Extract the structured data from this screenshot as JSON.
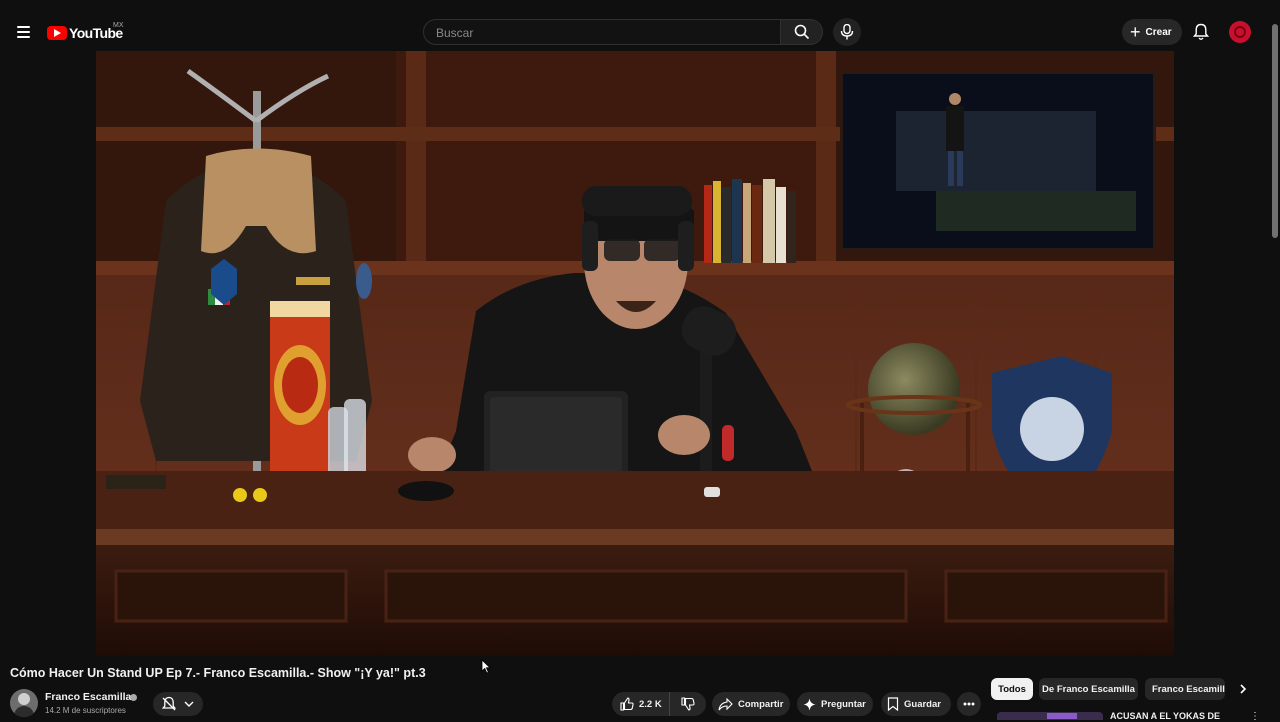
{
  "header": {
    "logo_text": "YouTube",
    "country_code": "MX",
    "search_placeholder": "Buscar",
    "create_label": "Crear"
  },
  "video": {
    "title": "Cómo Hacer Un Stand UP Ep 7.- Franco Escamilla.- Show \"¡Y ya!\" pt.3"
  },
  "channel": {
    "name": "Franco Escamilla",
    "subscribers": "14.2 M de suscriptores"
  },
  "actions": {
    "likes": "2.2 K",
    "share_label": "Compartir",
    "ask_label": "Preguntar",
    "save_label": "Guardar"
  },
  "chips": [
    "Todos",
    "De Franco Escamilla",
    "Franco Escamilla"
  ],
  "recommendation": {
    "title": "ACUSAN A EL YOKAS DE"
  },
  "colors": {
    "background": "#0f0f0f",
    "brand_red": "#ff0000",
    "pill": "#272727"
  }
}
